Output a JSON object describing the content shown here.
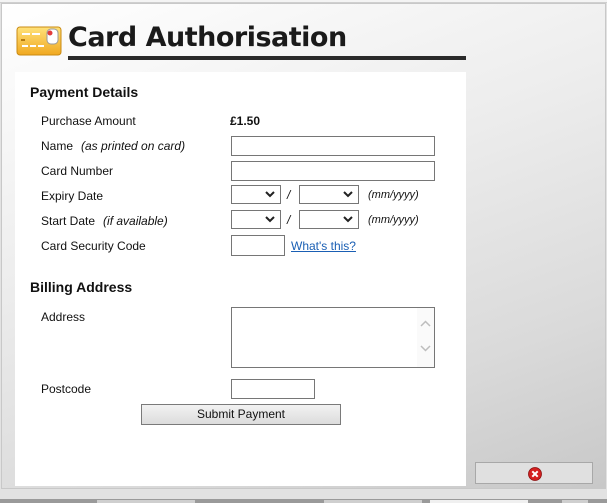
{
  "dialog": {
    "title": "Card Authorisation",
    "icon": "credit-card-icon"
  },
  "payment_details": {
    "heading": "Payment Details",
    "purchase_amount_label": "Purchase Amount",
    "purchase_amount_value": "£1.50",
    "name_label": "Name",
    "name_hint": "(as printed on card)",
    "name_value": "",
    "card_number_label": "Card Number",
    "card_number_value": "",
    "expiry_label": "Expiry Date",
    "expiry_month": "",
    "expiry_year": "",
    "expiry_separator": "/",
    "expiry_format": "(mm/yyyy)",
    "start_label": "Start Date",
    "start_hint": "(if available)",
    "start_month": "",
    "start_year": "",
    "start_separator": "/",
    "start_format": "(mm/yyyy)",
    "security_code_label": "Card Security Code",
    "security_code_value": "",
    "whats_this_link": "What's this?"
  },
  "billing_address": {
    "heading": "Billing Address",
    "address_label": "Address",
    "address_value": "",
    "postcode_label": "Postcode",
    "postcode_value": ""
  },
  "actions": {
    "submit_label": "Submit Payment",
    "close_icon": "close-circle-icon"
  }
}
